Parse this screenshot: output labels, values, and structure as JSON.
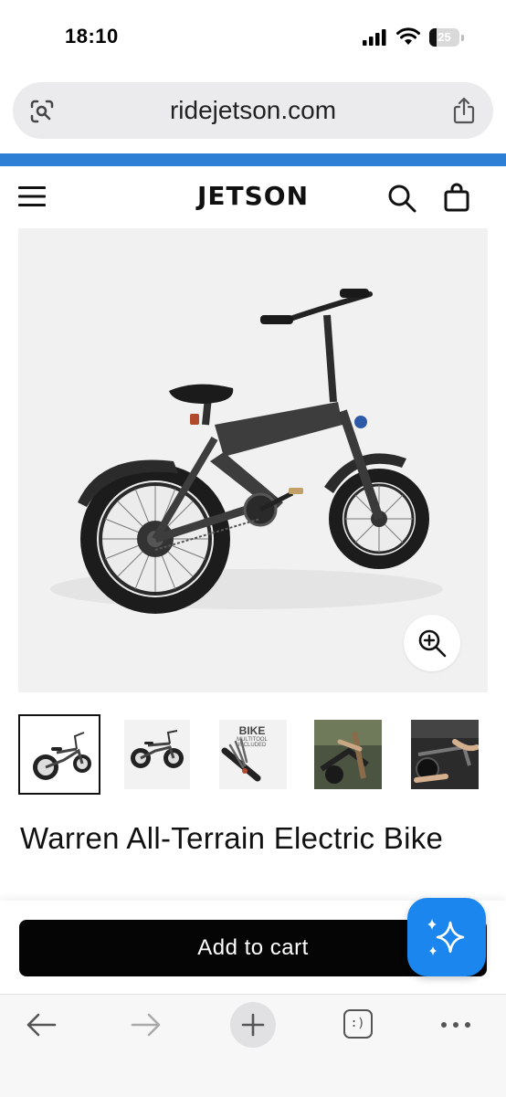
{
  "status_bar": {
    "time": "18:10",
    "battery_percent": 25,
    "battery_label": "25"
  },
  "browser": {
    "url": "ridejetson.com",
    "tabs_count": ":)"
  },
  "site_header": {
    "brand": "JETSON"
  },
  "product": {
    "title": "Warren All-Terrain Electric Bike",
    "thumbnails": [
      {
        "name": "bike-side-view"
      },
      {
        "name": "bike-profile"
      },
      {
        "name": "bike-multitool",
        "caption_lines": [
          "BIKE",
          "MULTITOOL",
          "INCLUDED"
        ]
      },
      {
        "name": "bike-folding"
      },
      {
        "name": "bike-in-trunk"
      }
    ],
    "selected_thumbnail": 0
  },
  "cart": {
    "add_label": "Add to cart"
  },
  "colors": {
    "accent": "#1a86ee",
    "button": "#050505",
    "promo": "#2d7fd6"
  }
}
